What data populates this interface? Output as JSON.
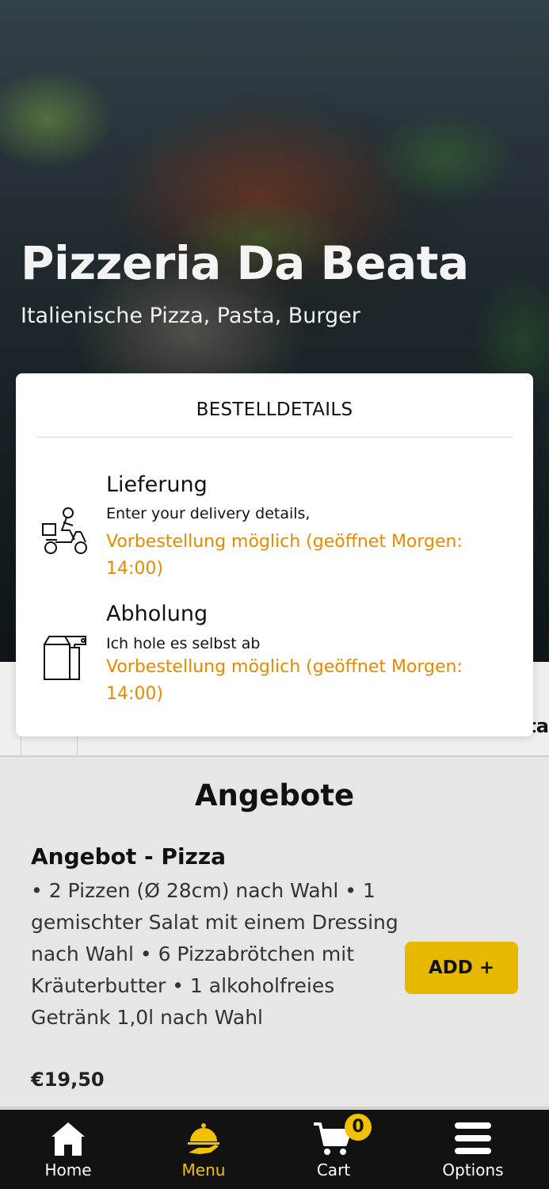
{
  "restaurant": {
    "name": "Pizzeria Da Beata",
    "cuisine": "Italienische Pizza, Pasta, Burger"
  },
  "order_details": {
    "title": "BESTELLDETAILS",
    "options": [
      {
        "name": "Lieferung",
        "description": "Enter your delivery details,",
        "note": "Vorbestellung möglich (geöffnet Morgen: 14:00)",
        "icon": "delivery-scooter-icon"
      },
      {
        "name": "Abholung",
        "description": "Ich hole es selbst ab",
        "note": "Vorbestellung möglich (geöffnet Morgen: 14:00)",
        "icon": "takeaway-bag-icon"
      }
    ]
  },
  "offers": {
    "section_title": "Angebote",
    "items": [
      {
        "name": "Angebot - Pizza",
        "description": "• 2 Pizzen (Ø 28cm) nach Wahl • 1 gemischter Salat mit einem Dressing nach Wahl • 6 Pizzabrötchen mit Kräuterbutter • 1 alkoholfreies Getränk 1,0l nach Wahl",
        "price": "€19,50",
        "add_label": "ADD +"
      }
    ]
  },
  "bottom_nav": {
    "items": [
      {
        "label": "Home",
        "icon": "home-icon"
      },
      {
        "label": "Menu",
        "icon": "menu-cloche-icon",
        "active": true
      },
      {
        "label": "Cart",
        "icon": "cart-icon",
        "badge": "0"
      },
      {
        "label": "Options",
        "icon": "hamburger-icon"
      }
    ]
  },
  "colors": {
    "accent": "#f2c200",
    "add_button": "#e7b800",
    "note_text": "#e68a00",
    "nav_background": "#121212"
  }
}
